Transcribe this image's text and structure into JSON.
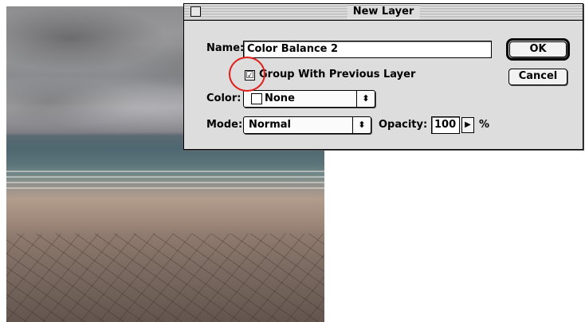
{
  "dialog": {
    "title": "New Layer",
    "name_label": "Name:",
    "name_value": "Color Balance 2",
    "group_checkbox_label": "Group With Previous Layer",
    "group_checked": true,
    "color_label": "Color:",
    "color_value": "None",
    "mode_label": "Mode:",
    "mode_value": "Normal",
    "opacity_label": "Opacity:",
    "opacity_value": "100",
    "opacity_unit": "%",
    "ok_label": "OK",
    "cancel_label": "Cancel"
  },
  "glyphs": {
    "checkmark": "☑",
    "popup_arrows": "⬍",
    "stepper_arrow": "▶"
  },
  "colors": {
    "dialog_bg": "#dddddd",
    "highlight_circle": "#e0201c"
  },
  "icons": [
    "close-box-icon",
    "checkbox-icon",
    "popup-arrows-icon",
    "stepper-arrow-icon",
    "color-swatch-icon"
  ]
}
